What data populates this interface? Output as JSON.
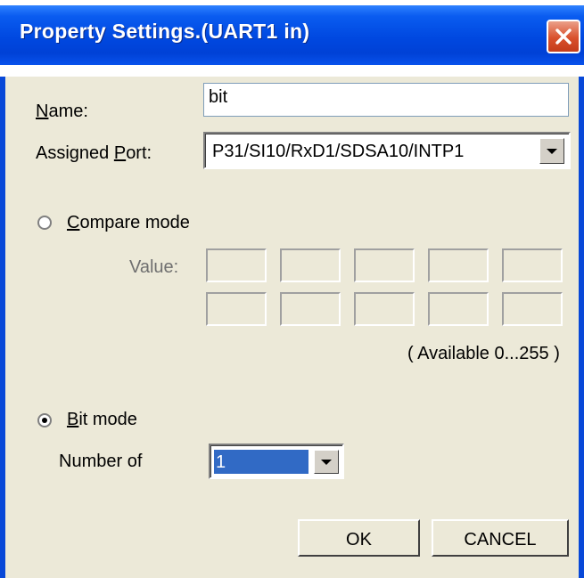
{
  "window": {
    "title": "Property Settings.(UART1 in)"
  },
  "form": {
    "name_label_first": "N",
    "name_label_rest": "ame:",
    "name_value": "bit",
    "port_label_first": "Assigned ",
    "port_label_ul": "P",
    "port_label_rest": "ort:",
    "port_value": "P31/SI10/RxD1/SDSA10/INTP1"
  },
  "compare": {
    "label_ul": "C",
    "label_rest": "ompare mode",
    "selected": false,
    "value_label": "Value:",
    "values_row1": [
      "",
      "",
      "",
      "",
      ""
    ],
    "values_row2": [
      "",
      "",
      "",
      "",
      ""
    ],
    "range_note": "( Available 0...255 )"
  },
  "bit": {
    "label_ul": "B",
    "label_rest": "it mode",
    "selected": true,
    "number_label": "Number of",
    "number_value": "1"
  },
  "buttons": {
    "ok": "OK",
    "cancel": "CANCEL"
  },
  "colors": {
    "title_bar": "#0048e0",
    "dialog_bg": "#ece9d8",
    "selection": "#316ac5",
    "close_button": "#d9502c"
  },
  "icons": {
    "close": "close-icon",
    "dropdown": "chevron-down-icon"
  }
}
